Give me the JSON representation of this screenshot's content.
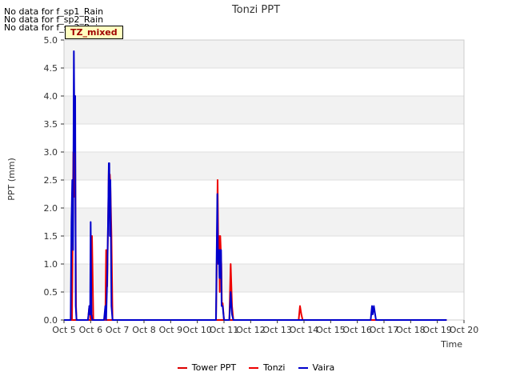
{
  "no_data_messages": [
    "No data for f_sp1_Rain",
    "No data for f_sp2_Rain",
    "No data for f_sp3_Rain"
  ],
  "badge": "TZ_mixed",
  "chart_data": {
    "type": "line",
    "title": "Tonzi PPT",
    "xlabel": "Time",
    "ylabel": "PPT (mm)",
    "xlim": [
      5,
      20
    ],
    "ylim": [
      0,
      5.0
    ],
    "x_ticks": [
      5,
      6,
      7,
      8,
      9,
      10,
      11,
      12,
      13,
      14,
      15,
      16,
      17,
      18,
      19,
      20
    ],
    "x_tick_labels": [
      "Oct 5",
      "Oct 6",
      "Oct 7",
      "Oct 8",
      "Oct 9",
      "Oct 10",
      "Oct 11",
      "Oct 12",
      "Oct 13",
      "Oct 14",
      "Oct 15",
      "Oct 16",
      "Oct 17",
      "Oct 18",
      "Oct 19",
      "Oct 20"
    ],
    "y_ticks": [
      0.0,
      0.5,
      1.0,
      1.5,
      2.0,
      2.5,
      3.0,
      3.5,
      4.0,
      4.5,
      5.0
    ],
    "y_tick_labels": [
      "0.0",
      "0.5",
      "1.0",
      "1.5",
      "2.0",
      "2.5",
      "3.0",
      "3.5",
      "4.0",
      "4.5",
      "5.0"
    ],
    "grid": true,
    "legend_position": "bottom-center",
    "series": [
      {
        "name": "Tower PPT",
        "color": "#dd0000",
        "x": [
          5.0,
          19.35
        ],
        "y": [
          0,
          0
        ]
      },
      {
        "name": "Tonzi",
        "color": "#ee0000",
        "x": [
          5.0,
          5.3,
          5.35,
          5.38,
          5.41,
          5.43,
          5.45,
          5.47,
          5.5,
          5.55,
          5.6,
          5.9,
          5.95,
          6.0,
          6.05,
          6.1,
          6.5,
          6.55,
          6.58,
          6.62,
          6.66,
          6.68,
          6.7,
          6.72,
          6.74,
          6.78,
          6.82,
          6.9,
          10.7,
          10.73,
          10.76,
          10.78,
          10.8,
          10.82,
          10.84,
          10.86,
          10.88,
          10.9,
          10.92,
          10.95,
          11.0,
          11.1,
          11.2,
          11.25,
          11.3,
          11.35,
          11.5,
          13.8,
          13.85,
          13.9,
          13.95,
          14.0,
          16.5,
          19.35
        ],
        "y": [
          0,
          0,
          3.0,
          2.2,
          4.0,
          2.0,
          0.25,
          0,
          0,
          0,
          0,
          0,
          0.25,
          0,
          1.5,
          0,
          0,
          0,
          1.25,
          0.6,
          2.0,
          2.7,
          2.0,
          2.6,
          2.4,
          1.5,
          0,
          0,
          0,
          1.0,
          2.5,
          1.5,
          1.0,
          1.5,
          0.5,
          1.5,
          1.25,
          1.0,
          0.3,
          0.3,
          0,
          0,
          0,
          1.0,
          0.25,
          0,
          0,
          0,
          0.25,
          0.1,
          0,
          0,
          0,
          0
        ]
      },
      {
        "name": "Vaira",
        "color": "#0000cc",
        "x": [
          5.0,
          5.25,
          5.28,
          5.31,
          5.34,
          5.37,
          5.4,
          5.42,
          5.44,
          5.47,
          5.5,
          5.6,
          5.9,
          5.95,
          5.98,
          6.0,
          6.03,
          6.06,
          6.1,
          6.5,
          6.55,
          6.58,
          6.62,
          6.66,
          6.68,
          6.7,
          6.72,
          6.74,
          6.78,
          6.82,
          6.9,
          10.7,
          10.72,
          10.75,
          10.77,
          10.79,
          10.81,
          10.83,
          10.85,
          10.87,
          10.89,
          10.91,
          10.95,
          11.0,
          11.1,
          11.2,
          11.25,
          11.3,
          11.35,
          11.5,
          16.5,
          16.55,
          16.58,
          16.62,
          16.7,
          19.35
        ],
        "y": [
          0,
          0,
          1.75,
          2.5,
          1.25,
          4.8,
          3.0,
          4.0,
          0.25,
          0,
          0,
          0,
          0,
          0.25,
          0.1,
          1.75,
          0.1,
          0,
          0,
          0,
          0.25,
          0,
          0.75,
          2.0,
          2.8,
          2.8,
          1.5,
          2.5,
          0.25,
          0,
          0,
          0,
          1.0,
          2.25,
          1.25,
          1.0,
          1.25,
          0.75,
          1.25,
          0.75,
          1.25,
          0.25,
          0.25,
          0,
          0,
          0,
          0.5,
          0.1,
          0,
          0,
          0,
          0.25,
          0.1,
          0.25,
          0,
          0
        ]
      }
    ]
  }
}
